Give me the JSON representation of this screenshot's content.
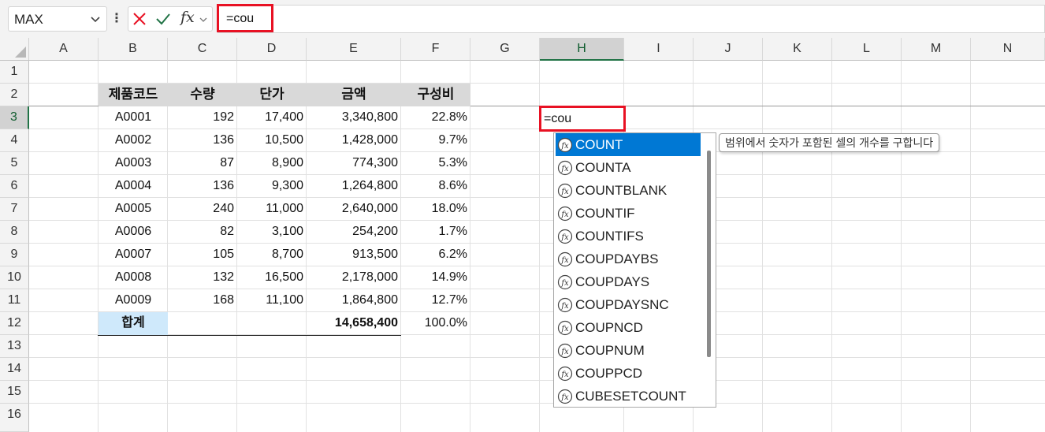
{
  "formula_bar": {
    "name_box": "MAX",
    "more_icon": "vertical-ellipsis",
    "cancel_icon": "x-icon",
    "enter_icon": "check-icon",
    "fx_label": "fx",
    "formula": "=cou"
  },
  "columns": [
    "A",
    "B",
    "C",
    "D",
    "E",
    "F",
    "G",
    "H",
    "I",
    "J",
    "K",
    "L",
    "M",
    "N"
  ],
  "selected_column": "H",
  "rows": [
    "1",
    "2",
    "3",
    "4",
    "5",
    "6",
    "7",
    "8",
    "9",
    "10",
    "11",
    "12",
    "13",
    "14",
    "15",
    "16"
  ],
  "selected_row": "3",
  "table": {
    "headers": [
      "제품코드",
      "수량",
      "단가",
      "금액",
      "구성비"
    ],
    "rows": [
      [
        "A0001",
        "192",
        "17,400",
        "3,340,800",
        "22.8%"
      ],
      [
        "A0002",
        "136",
        "10,500",
        "1,428,000",
        "9.7%"
      ],
      [
        "A0003",
        "87",
        "8,900",
        "774,300",
        "5.3%"
      ],
      [
        "A0004",
        "136",
        "9,300",
        "1,264,800",
        "8.6%"
      ],
      [
        "A0005",
        "240",
        "11,000",
        "2,640,000",
        "18.0%"
      ],
      [
        "A0006",
        "82",
        "3,100",
        "254,200",
        "1.7%"
      ],
      [
        "A0007",
        "105",
        "8,700",
        "913,500",
        "6.2%"
      ],
      [
        "A0008",
        "132",
        "16,500",
        "2,178,000",
        "14.9%"
      ],
      [
        "A0009",
        "168",
        "11,100",
        "1,864,800",
        "12.7%"
      ]
    ],
    "total_label": "합계",
    "total_amount": "14,658,400",
    "total_ratio": "100.0%"
  },
  "active_cell": {
    "ref": "H3",
    "content": "=cou"
  },
  "autocomplete": {
    "items": [
      "COUNT",
      "COUNTA",
      "COUNTBLANK",
      "COUNTIF",
      "COUNTIFS",
      "COUPDAYBS",
      "COUPDAYS",
      "COUPDAYSNC",
      "COUPNCD",
      "COUPNUM",
      "COUPPCD",
      "CUBESETCOUNT"
    ],
    "highlighted": 0,
    "item_icon": "function-fx-icon",
    "tooltip": "범위에서 숫자가 포함된 셀의 개수를 구합니다"
  },
  "colors": {
    "accent_green": "#217346",
    "highlight_red": "#e81123",
    "selection_blue": "#0078d4",
    "header_fill": "#d9d9d9",
    "total_fill": "#cfe9fb"
  }
}
